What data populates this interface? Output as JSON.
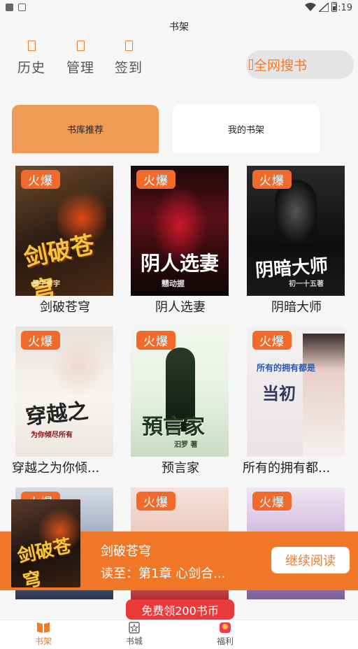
{
  "status_bar": {
    "time": "3:19"
  },
  "page_title": "书架",
  "quick_links": [
    {
      "label": "历史",
      "icon": "history-icon"
    },
    {
      "label": "管理",
      "icon": "manage-icon"
    },
    {
      "label": "签到",
      "icon": "checkin-icon"
    }
  ],
  "search_all": {
    "label": "全网搜书",
    "icon": "search-icon"
  },
  "tabs": {
    "recommend": "书库推荐",
    "my_shelf": "我的书架"
  },
  "badge_label": "火爆",
  "books": [
    {
      "title": "剑破苍穹",
      "cover_text": "剑破苍穹",
      "cover_sub": "墨生青宇"
    },
    {
      "title": "阴人选妻",
      "cover_text": "阴人选妻",
      "cover_sub": "戆动握"
    },
    {
      "title": "阴暗大师",
      "cover_text": "阴暗大师",
      "cover_sub": "初一十五著"
    },
    {
      "title": "穿越之为你倾...",
      "cover_text": "穿越之",
      "cover_sub": "为你倾尽所有"
    },
    {
      "title": "预言家",
      "cover_text": "預言家",
      "cover_sub": "汩罗 著"
    },
    {
      "title": "所有的拥有都...",
      "cover_text": "当初",
      "cover_sub": "所有的拥有都是"
    }
  ],
  "continue_reading": {
    "title": "剑破苍穹",
    "progress": "读至：第1章 心剑合...",
    "button": "继续阅读",
    "cover_text": "剑破苍穹"
  },
  "promo": {
    "label": "免费领200书币"
  },
  "tabbar": [
    {
      "label": "书架",
      "icon": "bookshelf-icon"
    },
    {
      "label": "书城",
      "icon": "bookstore-icon"
    },
    {
      "label": "福利",
      "icon": "gift-icon"
    }
  ],
  "colors": {
    "accent": "#ef7b2c",
    "badge": "#f06a2b",
    "bar": "#f07727",
    "promo": "#ea3a3a"
  }
}
